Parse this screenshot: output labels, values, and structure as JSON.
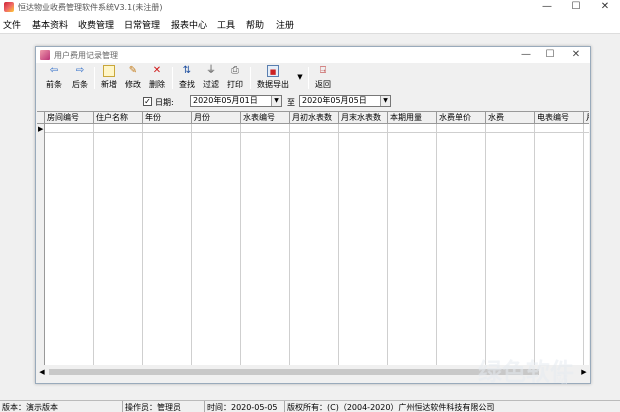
{
  "app": {
    "title": "恒达物业收费管理软件系统V3.1(未注册)"
  },
  "window_controls": {
    "minimize": "—",
    "maximize": "☐",
    "close": "✕"
  },
  "menu": [
    "文件",
    "基本资料",
    "收费管理",
    "日常管理",
    "报表中心",
    "工具",
    "帮助",
    "注册"
  ],
  "child": {
    "title": "用户费用记录管理",
    "controls": {
      "minimize": "—",
      "maximize": "☐",
      "close": "✕"
    }
  },
  "toolbar": {
    "prev": "前条",
    "next": "后条",
    "add": "新增",
    "edit": "修改",
    "delete": "删除",
    "query": "查找",
    "filter": "过滤",
    "print": "打印",
    "export": "数据导出",
    "back": "返回"
  },
  "filter": {
    "checkbox_mark": "✓",
    "date_label": "日期:",
    "date_from": "2020年05月01日",
    "to_label": "至",
    "date_to": "2020年05月05日",
    "dropdown_arrow": "▼"
  },
  "grid": {
    "row_indicator": "▶",
    "columns": [
      "房间编号",
      "住户名称",
      "年份",
      "月份",
      "水表编号",
      "月初水表数",
      "月末水表数",
      "本期用量",
      "水费单价",
      "水费",
      "电表编号",
      "月"
    ]
  },
  "scroll": {
    "left": "◀",
    "right": "▶"
  },
  "status": {
    "version": "版本：演示版本",
    "operator": "操作员：管理员",
    "time": "时间：2020-05-05",
    "copyright": "版权所有：(C)（2004-2020）广州恒达软件科技有限公司"
  },
  "watermark": {
    "text": "绿色软件",
    "sub": "站"
  }
}
